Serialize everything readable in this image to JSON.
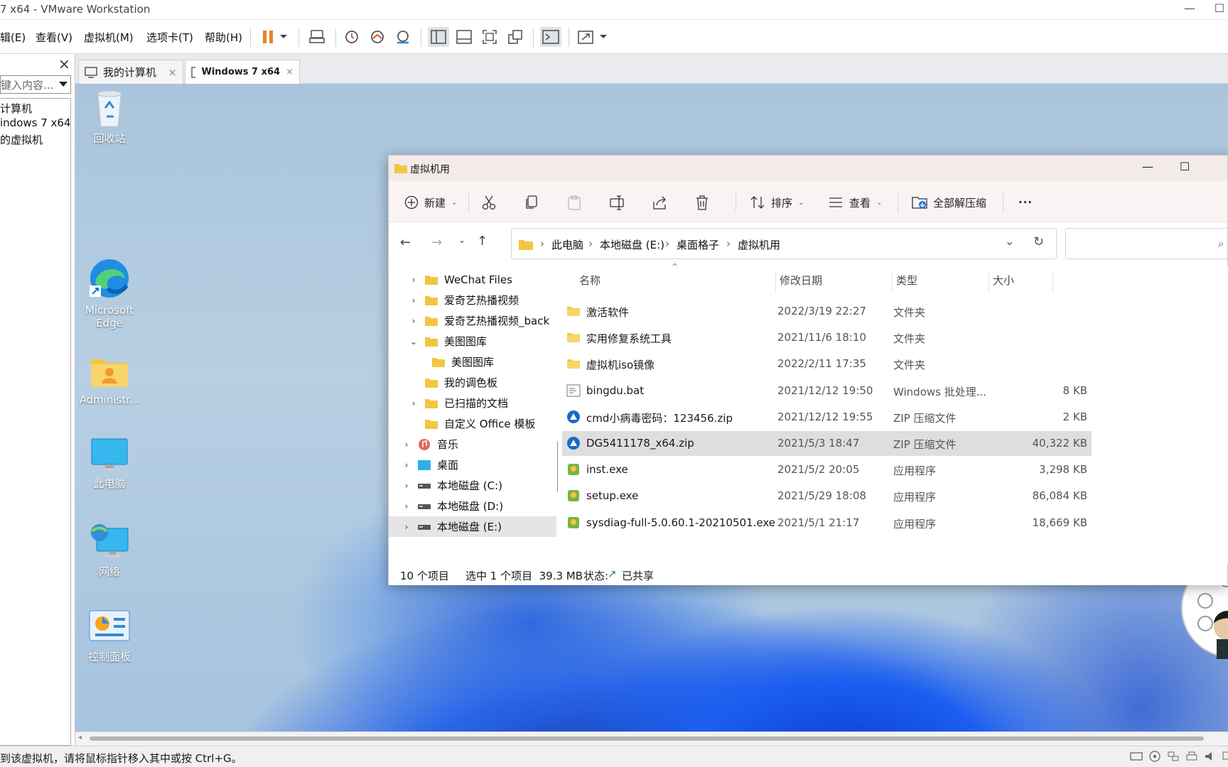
{
  "window": {
    "title": "7 x64 - VMware Workstation"
  },
  "menu": [
    "辑(E)",
    "查看(V)",
    "虚拟机(M)",
    "选项卡(T)",
    "帮助(H)"
  ],
  "toolbar_icons": [
    "pause-icon",
    "dropdown-icon",
    "send-keys-icon",
    "snapshot-icon",
    "revert-snapshot-icon",
    "snapshot-manager-icon",
    "library-view-icon",
    "thumbnail-view-icon",
    "fullscreen-icon",
    "unity-icon",
    "console-icon",
    "stretch-icon"
  ],
  "library": {
    "close_glyph": "×",
    "search_placeholder": "键入内容...",
    "items": [
      "计算机",
      "indows 7 x64",
      "的虚拟机"
    ]
  },
  "tabs": [
    {
      "label": "我的计算机",
      "active": false
    },
    {
      "label": "Windows 7 x64",
      "active": true
    }
  ],
  "desktop": {
    "icons": [
      "回收站",
      "Microsoft Edge",
      "Administr...",
      "此电脑",
      "网络",
      "控制面板"
    ]
  },
  "explorer": {
    "title": "虚拟机用",
    "toolbar": {
      "new": "新建",
      "sort": "排序",
      "view": "查看",
      "extract_all": "全部解压缩",
      "more": "···"
    },
    "breadcrumbs": [
      "此电脑",
      "本地磁盘 (E:)",
      "桌面格子",
      "虚拟机用"
    ],
    "nav": [
      {
        "label": "WeChat Files",
        "chev": ">",
        "indent": 2,
        "icon": "folder"
      },
      {
        "label": "爱奇艺热播视频",
        "chev": ">",
        "indent": 2,
        "icon": "folder"
      },
      {
        "label": "爱奇艺热播视频_back",
        "chev": ">",
        "indent": 2,
        "icon": "folder"
      },
      {
        "label": "美图图库",
        "chev": "v",
        "indent": 2,
        "icon": "folder"
      },
      {
        "label": "美图图库",
        "chev": "",
        "indent": 3,
        "icon": "folder"
      },
      {
        "label": "我的调色板",
        "chev": "",
        "indent": 2,
        "icon": "folder"
      },
      {
        "label": "已扫描的文档",
        "chev": ">",
        "indent": 2,
        "icon": "folder"
      },
      {
        "label": "自定义 Office 模板",
        "chev": "",
        "indent": 2,
        "icon": "folder"
      },
      {
        "label": "音乐",
        "chev": ">",
        "indent": 1,
        "icon": "music"
      },
      {
        "label": "桌面",
        "chev": ">",
        "indent": 1,
        "icon": "desktop"
      },
      {
        "label": "本地磁盘 (C:)",
        "chev": ">",
        "indent": 1,
        "icon": "drive"
      },
      {
        "label": "本地磁盘 (D:)",
        "chev": ">",
        "indent": 1,
        "icon": "drive"
      },
      {
        "label": "本地磁盘 (E:)",
        "chev": ">",
        "indent": 1,
        "icon": "drive",
        "selected": true
      }
    ],
    "columns": {
      "name": "名称",
      "date": "修改日期",
      "type": "类型",
      "size": "大小"
    },
    "files": [
      {
        "name": "激活软件",
        "date": "2022/3/19 22:27",
        "type": "文件夹",
        "size": "",
        "icon": "folder"
      },
      {
        "name": "实用修复系统工具",
        "date": "2021/11/6 18:10",
        "type": "文件夹",
        "size": "",
        "icon": "folder"
      },
      {
        "name": "虚拟机iso镜像",
        "date": "2022/2/11 17:35",
        "type": "文件夹",
        "size": "",
        "icon": "folder"
      },
      {
        "name": "bingdu.bat",
        "date": "2021/12/12 19:50",
        "type": "Windows 批处理...",
        "size": "8 KB",
        "icon": "bat"
      },
      {
        "name": "cmd小病毒密码：123456.zip",
        "date": "2021/12/12 19:55",
        "type": "ZIP 压缩文件",
        "size": "2 KB",
        "icon": "zip"
      },
      {
        "name": "DG5411178_x64.zip",
        "date": "2021/5/3 18:47",
        "type": "ZIP 压缩文件",
        "size": "40,322 KB",
        "icon": "zip",
        "selected": true
      },
      {
        "name": "inst.exe",
        "date": "2021/5/2 20:05",
        "type": "应用程序",
        "size": "3,298 KB",
        "icon": "exe"
      },
      {
        "name": "setup.exe",
        "date": "2021/5/29 18:08",
        "type": "应用程序",
        "size": "86,084 KB",
        "icon": "exe"
      },
      {
        "name": "sysdiag-full-5.0.60.1-20210501.exe",
        "date": "2021/5/1 21:17",
        "type": "应用程序",
        "size": "18,669 KB",
        "icon": "exe"
      }
    ],
    "status": {
      "count": "10 个项目",
      "selection": "选中 1 个项目  39.3 MB",
      "state_label": "状态:",
      "state_value": "已共享"
    }
  },
  "statusbar": {
    "hint": "到该虚拟机，请将鼠标指针移入其中或按 Ctrl+G。"
  },
  "colors": {
    "accent": "#0067c0",
    "folder": "#f4c542",
    "pause": "#e8821e"
  }
}
